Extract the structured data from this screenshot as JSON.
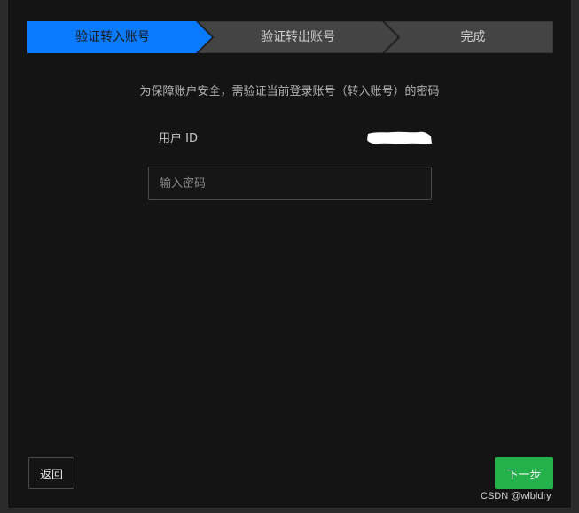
{
  "steps": [
    {
      "label": "验证转入账号",
      "state": "active"
    },
    {
      "label": "验证转出账号",
      "state": "inactive"
    },
    {
      "label": "完成",
      "state": "inactive"
    }
  ],
  "colors": {
    "step_active": "#0a7aff",
    "step_inactive": "#444444",
    "step_border": "#2a2a2a",
    "next_button": "#24b04a"
  },
  "notice": "为保障账户安全，需验证当前登录账号（转入账号）的密码",
  "user_id": {
    "label": "用户 ID"
  },
  "password": {
    "placeholder": "输入密码",
    "value": ""
  },
  "buttons": {
    "back": "返回",
    "next": "下一步"
  },
  "watermark": "CSDN @wlbldry"
}
